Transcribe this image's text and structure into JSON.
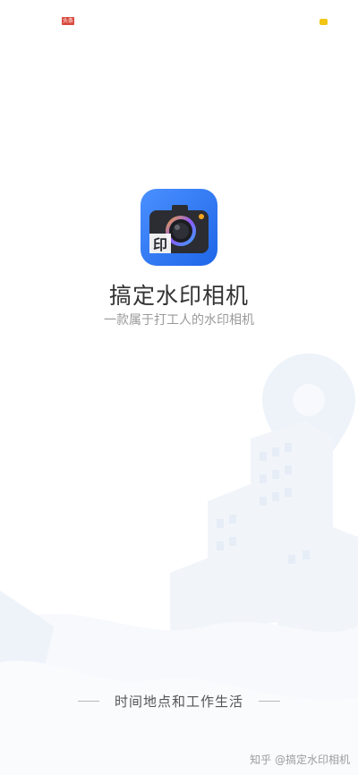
{
  "status_bar": {
    "left_badge_text": "头条"
  },
  "app": {
    "name": "搞定水印相机",
    "slogan": "一款属于打工人的水印相机",
    "logo_glyph": "印",
    "logo_icon": "camera-icon"
  },
  "footer": {
    "tagline": "时间地点和工作生活"
  },
  "watermark": {
    "text": "知乎 @搞定水印相机"
  },
  "colors": {
    "brand_blue": "#2f7cf6",
    "camera_body": "#2b2d33",
    "status_red": "#d94a3f",
    "status_yellow": "#f2c613"
  }
}
